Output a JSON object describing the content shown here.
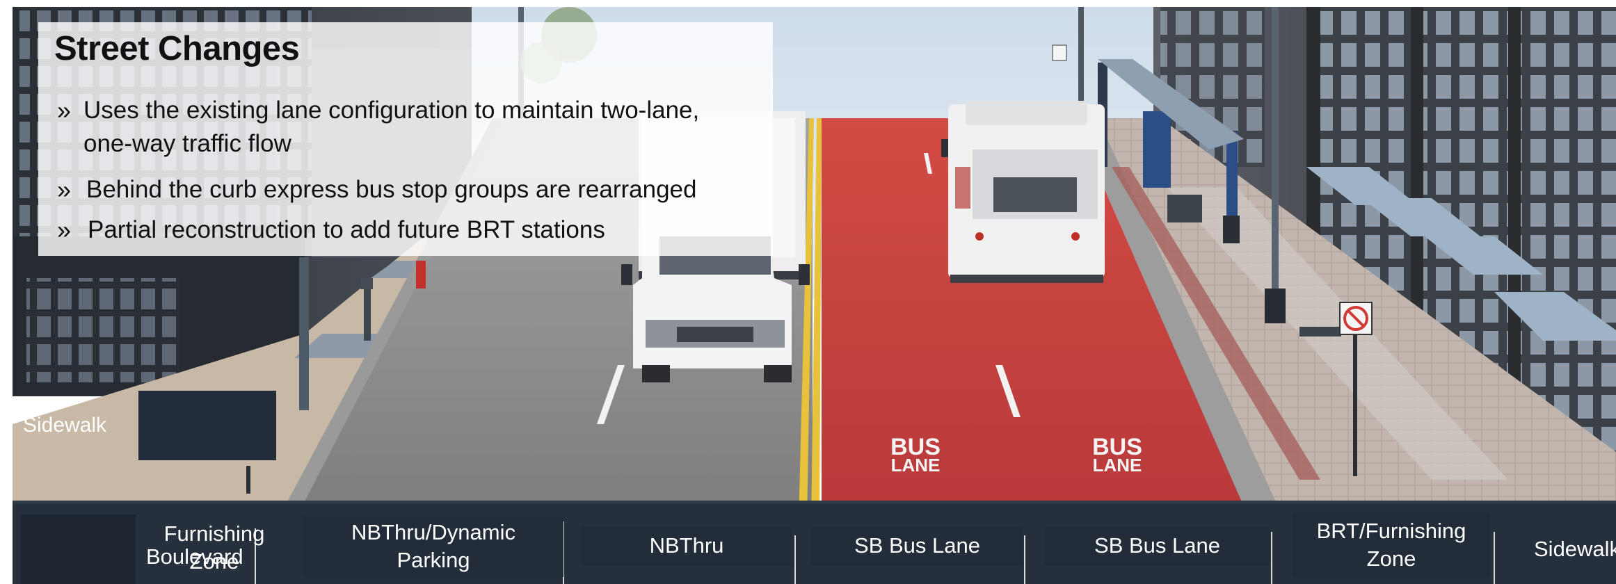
{
  "slide": {
    "title": "Street Changes",
    "bullet_glyph": "»",
    "bullets": [
      "Uses the existing lane configuration to maintain two-lane, one-way traffic flow",
      "Behind the curb express bus stop groups are rearranged",
      "Partial reconstruction to add future BRT stations"
    ]
  },
  "scene": {
    "label_sidewalk_left": "Sidewalk",
    "pavement_marking": "BUS LANE",
    "pavement_marking_line1": "BUS",
    "pavement_marking_line2": "LANE",
    "sign_icon": "no-parking-sign-icon",
    "colors": {
      "bus_lane": "#c9453f",
      "sky": "#dde7f2",
      "label_bg": "#222d39",
      "road": "#8a8a8a"
    }
  },
  "lane_labels": {
    "boulevard": "Boulevard",
    "furnishing_zone": "Furnishing Zone",
    "nbthru_dynamic_parking": "NBThru/Dynamic Parking",
    "nbthru": "NBThru",
    "sb_bus_lane_1": "SB Bus Lane",
    "sb_bus_lane_2": "SB Bus Lane",
    "brt_furnishing_zone": "BRT/Furnishing Zone",
    "sidewalk_right": "Sidewalk"
  }
}
